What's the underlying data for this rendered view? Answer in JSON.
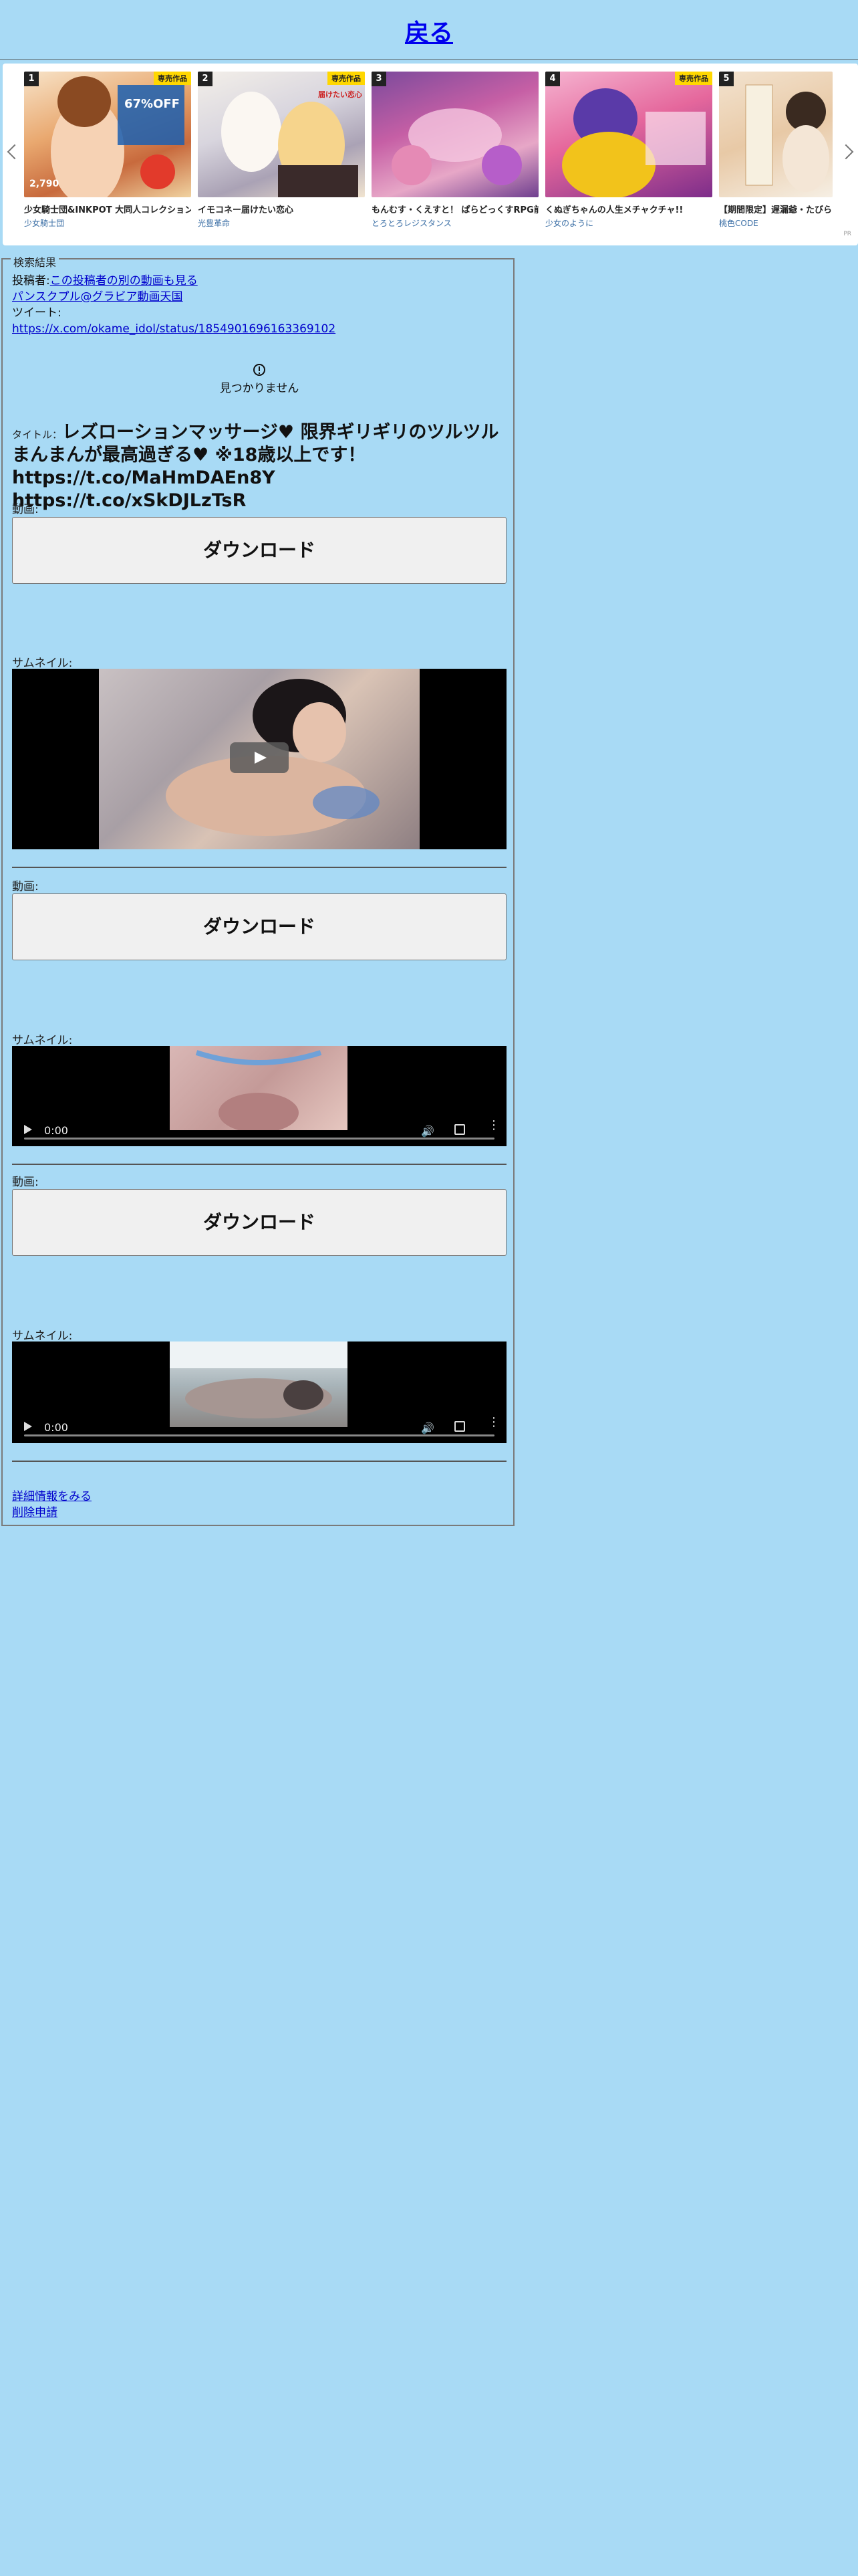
{
  "header": {
    "back_label": "戻る"
  },
  "carousel": {
    "pr_label": "PR",
    "items": [
      {
        "rank": "1",
        "badge": "専売作品",
        "title": "少女騎士団&INKPOT 大同人コレクション",
        "circle": "少女騎士団",
        "img_text": "67%OFF",
        "price": "2,790"
      },
      {
        "rank": "2",
        "badge": "専売作品",
        "title": "イモコネー届けたい恋心",
        "circle": "光豊革命",
        "img_text": "届けたい恋心"
      },
      {
        "rank": "3",
        "badge": "",
        "title": "もんむす・くえすと！ ぱらどっくすRPG前章",
        "circle": "とろとろレジスタンス"
      },
      {
        "rank": "4",
        "badge": "専売作品",
        "title": "くぬぎちゃんの人生メチャクチャ!!",
        "circle": "少女のように"
      },
      {
        "rank": "5",
        "badge": "",
        "title": "【期間限定】遅漏爺・たびらこ",
        "circle": "桃色CODE"
      }
    ]
  },
  "results": {
    "legend": "検索結果",
    "poster_label": "投稿者:",
    "poster_link": "この投稿者の別の動画も見る",
    "account_name": "パンスクプル@グラビア動画天国",
    "tweet_label": "ツイート:",
    "tweet_url": "https://x.com/okame_idol/status/1854901696163369102",
    "not_found": "見つかりません",
    "title_label": "タイトル：",
    "title_text": "レズローションマッサージ♥ 限界ギリギリのツルツルまんまんが最高過ぎる♥ ※18歳以上です！ https://t.co/MaHmDAEn8Y https://t.co/xSkDJLzTsR",
    "videos": [
      {
        "video_label": "動画:",
        "download_label": "ダウンロード",
        "thumb_label": "サムネイル:"
      },
      {
        "video_label": "動画:",
        "download_label": "ダウンロード",
        "thumb_label": "サムネイル:",
        "time": "0:00"
      },
      {
        "video_label": "動画:",
        "download_label": "ダウンロード",
        "thumb_label": "サムネイル:",
        "time": "0:00"
      }
    ],
    "details_link": "詳細情報をみる",
    "delete_link": "削除申請"
  },
  "colors": {
    "background": "#a8daf5",
    "link": "#0000cc"
  }
}
